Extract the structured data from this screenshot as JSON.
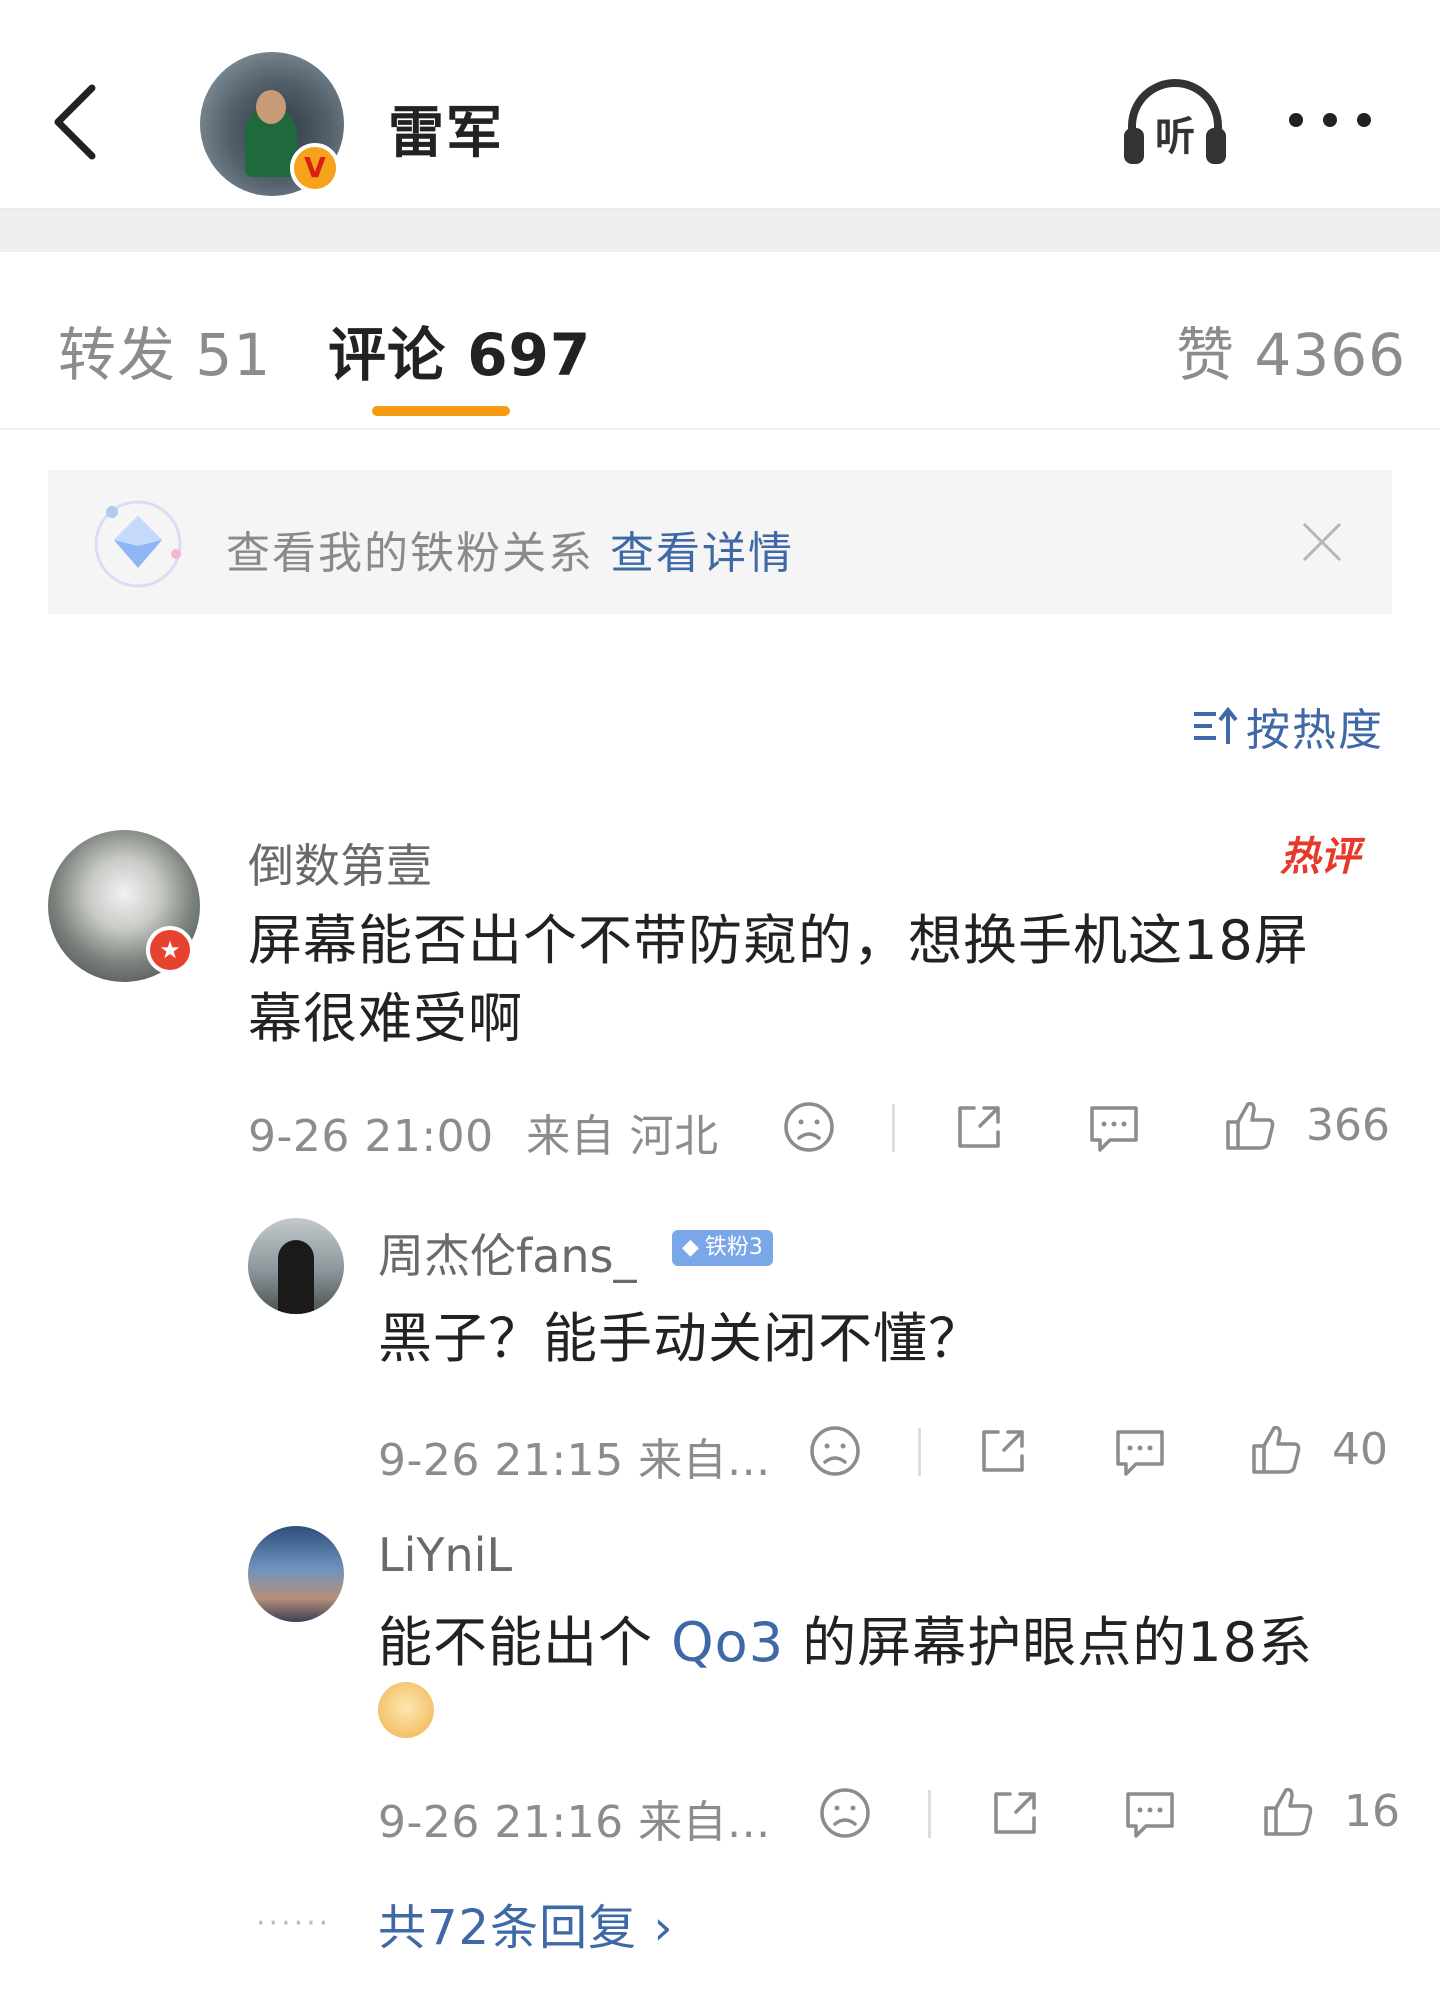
{
  "header": {
    "back_icon": "chevron-left-icon",
    "username": "雷军",
    "verified_badge": "V",
    "listen_label": "听",
    "more_icon": "more-dots-icon"
  },
  "tabs": [
    {
      "label": "转发 51"
    },
    {
      "label": "评论 697",
      "active": true
    },
    {
      "label": "赞 4366"
    }
  ],
  "fan_banner": {
    "text": "查看我的铁粉关系",
    "link": "查看详情",
    "close_icon": "close-icon"
  },
  "sort": {
    "label": "按热度",
    "icon": "sort-icon"
  },
  "comments": [
    {
      "username": "倒数第壹",
      "hot_tag": "热评",
      "text_line1": "屏幕能否出个不带防窥的，想换手机这18屏",
      "text_line2": "幕很难受啊",
      "time": "9-26 21:00",
      "location": "来自 河北",
      "likes": "366"
    }
  ],
  "replies": [
    {
      "username": "周杰伦fans_",
      "badge": "铁粉3",
      "text": "黑子？能手动关闭不懂？",
      "meta": "9-26 21:15  来自...",
      "likes": "40"
    },
    {
      "username": "LiYniL",
      "text_before": "能不能出个",
      "text_link": "Qo3",
      "text_after": "的屏幕护眼点的18系",
      "meta": "9-26 21:16  来自...",
      "likes": "16"
    }
  ],
  "more_replies": {
    "dots": "······",
    "label": "共72条回复 ›"
  },
  "colors": {
    "accent_orange": "#f69c12",
    "link_blue": "#3e69a6",
    "hot_red": "#e7392b"
  }
}
